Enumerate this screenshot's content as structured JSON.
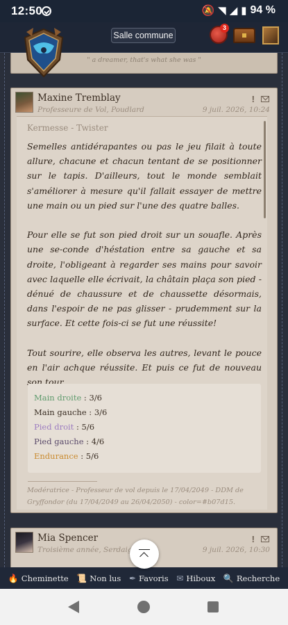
{
  "status_bar": {
    "time": "12:50",
    "battery": "94 %"
  },
  "header": {
    "room_button": "Salle commune",
    "notification_count": "3"
  },
  "previous_post": {
    "signature": "\" a dreamer, that's what she was \""
  },
  "posts": [
    {
      "author": "Maxine Tremblay",
      "role": "Professeure de Vol, Poudlard",
      "date": "9 juil. 2026, 10:24",
      "title": "Kermesse - Twister",
      "paragraphs": [
        "Semelles antidérapantes ou pas le jeu filait à toute allure, chacune et chacun tentant de se positionner sur le tapis. D'ailleurs, tout le monde semblait s'améliorer à mesure qu'il fallait essayer de mettre une main ou un pied sur l'une des quatre balles.",
        "Pour elle se fut son pied droit sur un souafle. Après une se-conde d'héstation entre sa gauche et sa droite, l'obligeant à regarder ses mains pour savoir avec laquelle elle écrivait, la châtain plaça son pied - dénué de chaussure et de chaussette désormais, dans l'espoir de ne pas glisser - prudemment sur la surface. Et cette fois-ci se fut une réussite!",
        "Tout sourire, elle observa les autres, levant le pouce en l'air achque réussite. Et puis ce fut de nouveau son tour."
      ],
      "stats": [
        {
          "label": "Main droite",
          "value": " : 3/6",
          "color": "#5e9a6c"
        },
        {
          "label": "Main gauche",
          "value": " : 3/6",
          "color": "#3a2e24"
        },
        {
          "label": "Pied droit",
          "value": " : 5/6",
          "color": "#9c7cc0"
        },
        {
          "label": "Pied gauche",
          "value": " : 4/6",
          "color": "#5a4a6a"
        },
        {
          "label": "Endurance",
          "value": " : 5/6",
          "color": "#c98a2e"
        }
      ],
      "signature": "Modératrice - Professeur de vol depuis le 17/04/2049 - DDM de Gryffondor (du 17/04/2049 au 26/04/2050) - color=#b07d15."
    },
    {
      "author": "Mia Spencer",
      "role": "Troisième année, Serdaigle",
      "date": "9 juil. 2026, 10:30"
    }
  ],
  "bottom_nav": [
    {
      "label": "Cheminette",
      "icon": "flame-icon",
      "glyph": "🔥"
    },
    {
      "label": "Non lus",
      "icon": "scroll-icon",
      "glyph": "📜"
    },
    {
      "label": "Favoris",
      "icon": "feather-icon",
      "glyph": "✒"
    },
    {
      "label": "Hiboux",
      "icon": "envelope-icon",
      "glyph": "✉"
    },
    {
      "label": "Recherche",
      "icon": "search-icon",
      "glyph": "🔍"
    }
  ]
}
